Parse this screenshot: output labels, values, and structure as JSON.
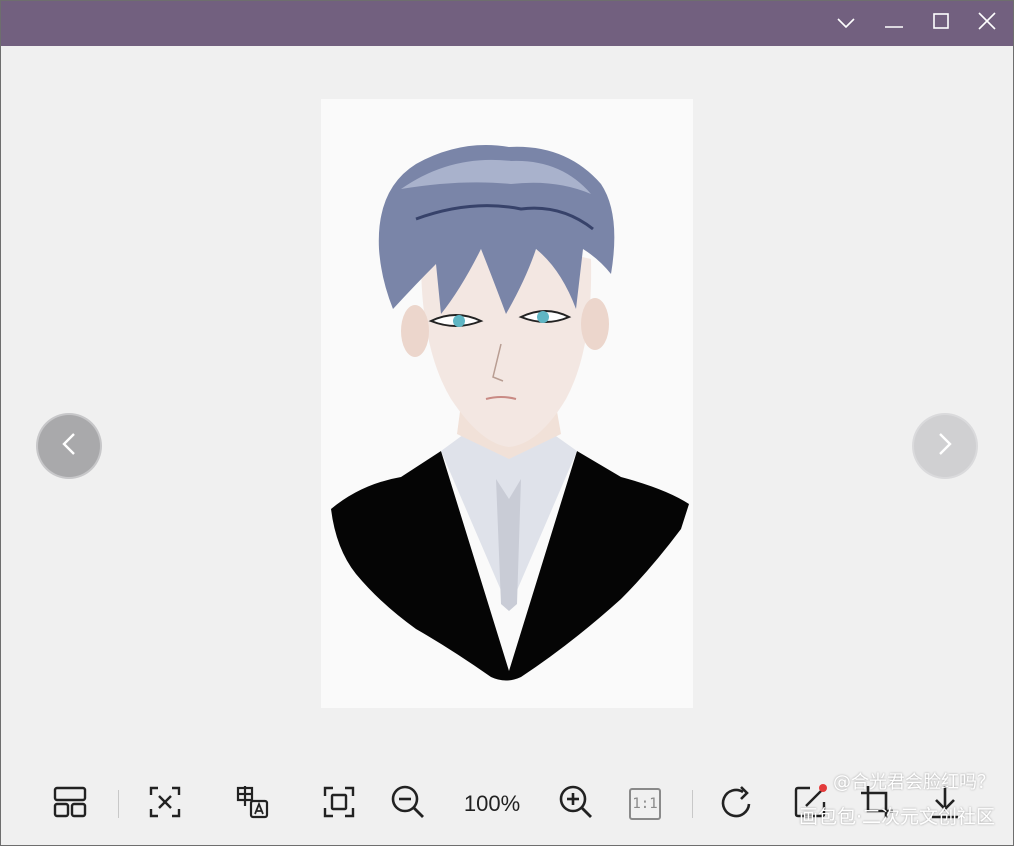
{
  "window": {
    "controls": {
      "dropdown_icon": "chevron-down-icon",
      "minimize_icon": "minimize-icon",
      "maximize_icon": "maximize-icon",
      "close_icon": "close-icon"
    },
    "titlebar_color": "#72607f"
  },
  "viewer": {
    "image_description_icon": "anime-portrait-image",
    "prev_icon": "chevron-left-icon",
    "next_icon": "chevron-right-icon"
  },
  "toolbar": {
    "zoom_level": "100%",
    "tools": [
      "thumbnails-icon",
      "ocr-text-icon",
      "translate-icon",
      "fit-screen-icon",
      "zoom-out-icon",
      "zoom-in-icon",
      "actual-size-icon",
      "rotate-icon",
      "edit-icon",
      "crop-icon",
      "download-icon"
    ],
    "actual_size_label": "1:1"
  },
  "watermark": {
    "line1": "@合光君会脸红吗？",
    "line2": "画包包·二次元文创社区"
  }
}
